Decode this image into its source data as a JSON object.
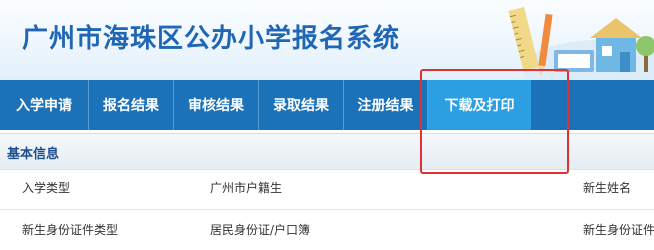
{
  "header": {
    "site_title": "广州市海珠区公办小学报名系统"
  },
  "nav": {
    "items": [
      {
        "label": "入学申请"
      },
      {
        "label": "报名结果"
      },
      {
        "label": "审核结果"
      },
      {
        "label": "录取结果"
      },
      {
        "label": "注册结果"
      },
      {
        "label": "下载及打印"
      }
    ],
    "active_index": 5
  },
  "section": {
    "title": "基本信息"
  },
  "info": {
    "row1": {
      "label": "入学类型",
      "value": "广州市户籍生",
      "label2": "新生姓名"
    },
    "row2": {
      "label": "新生身份证件类型",
      "value": "居民身份证/户口簿",
      "label2": "新生身份证件"
    }
  },
  "colors": {
    "title_blue": "#1f67b4",
    "nav_bg": "#1c72b8",
    "nav_active": "#2c9ee2",
    "section_title": "#1f4e8c",
    "highlight_red": "#e03232"
  },
  "icons": [
    "ruler-icon",
    "pencil-icon",
    "book-icon",
    "house-icon",
    "tree-icon"
  ]
}
